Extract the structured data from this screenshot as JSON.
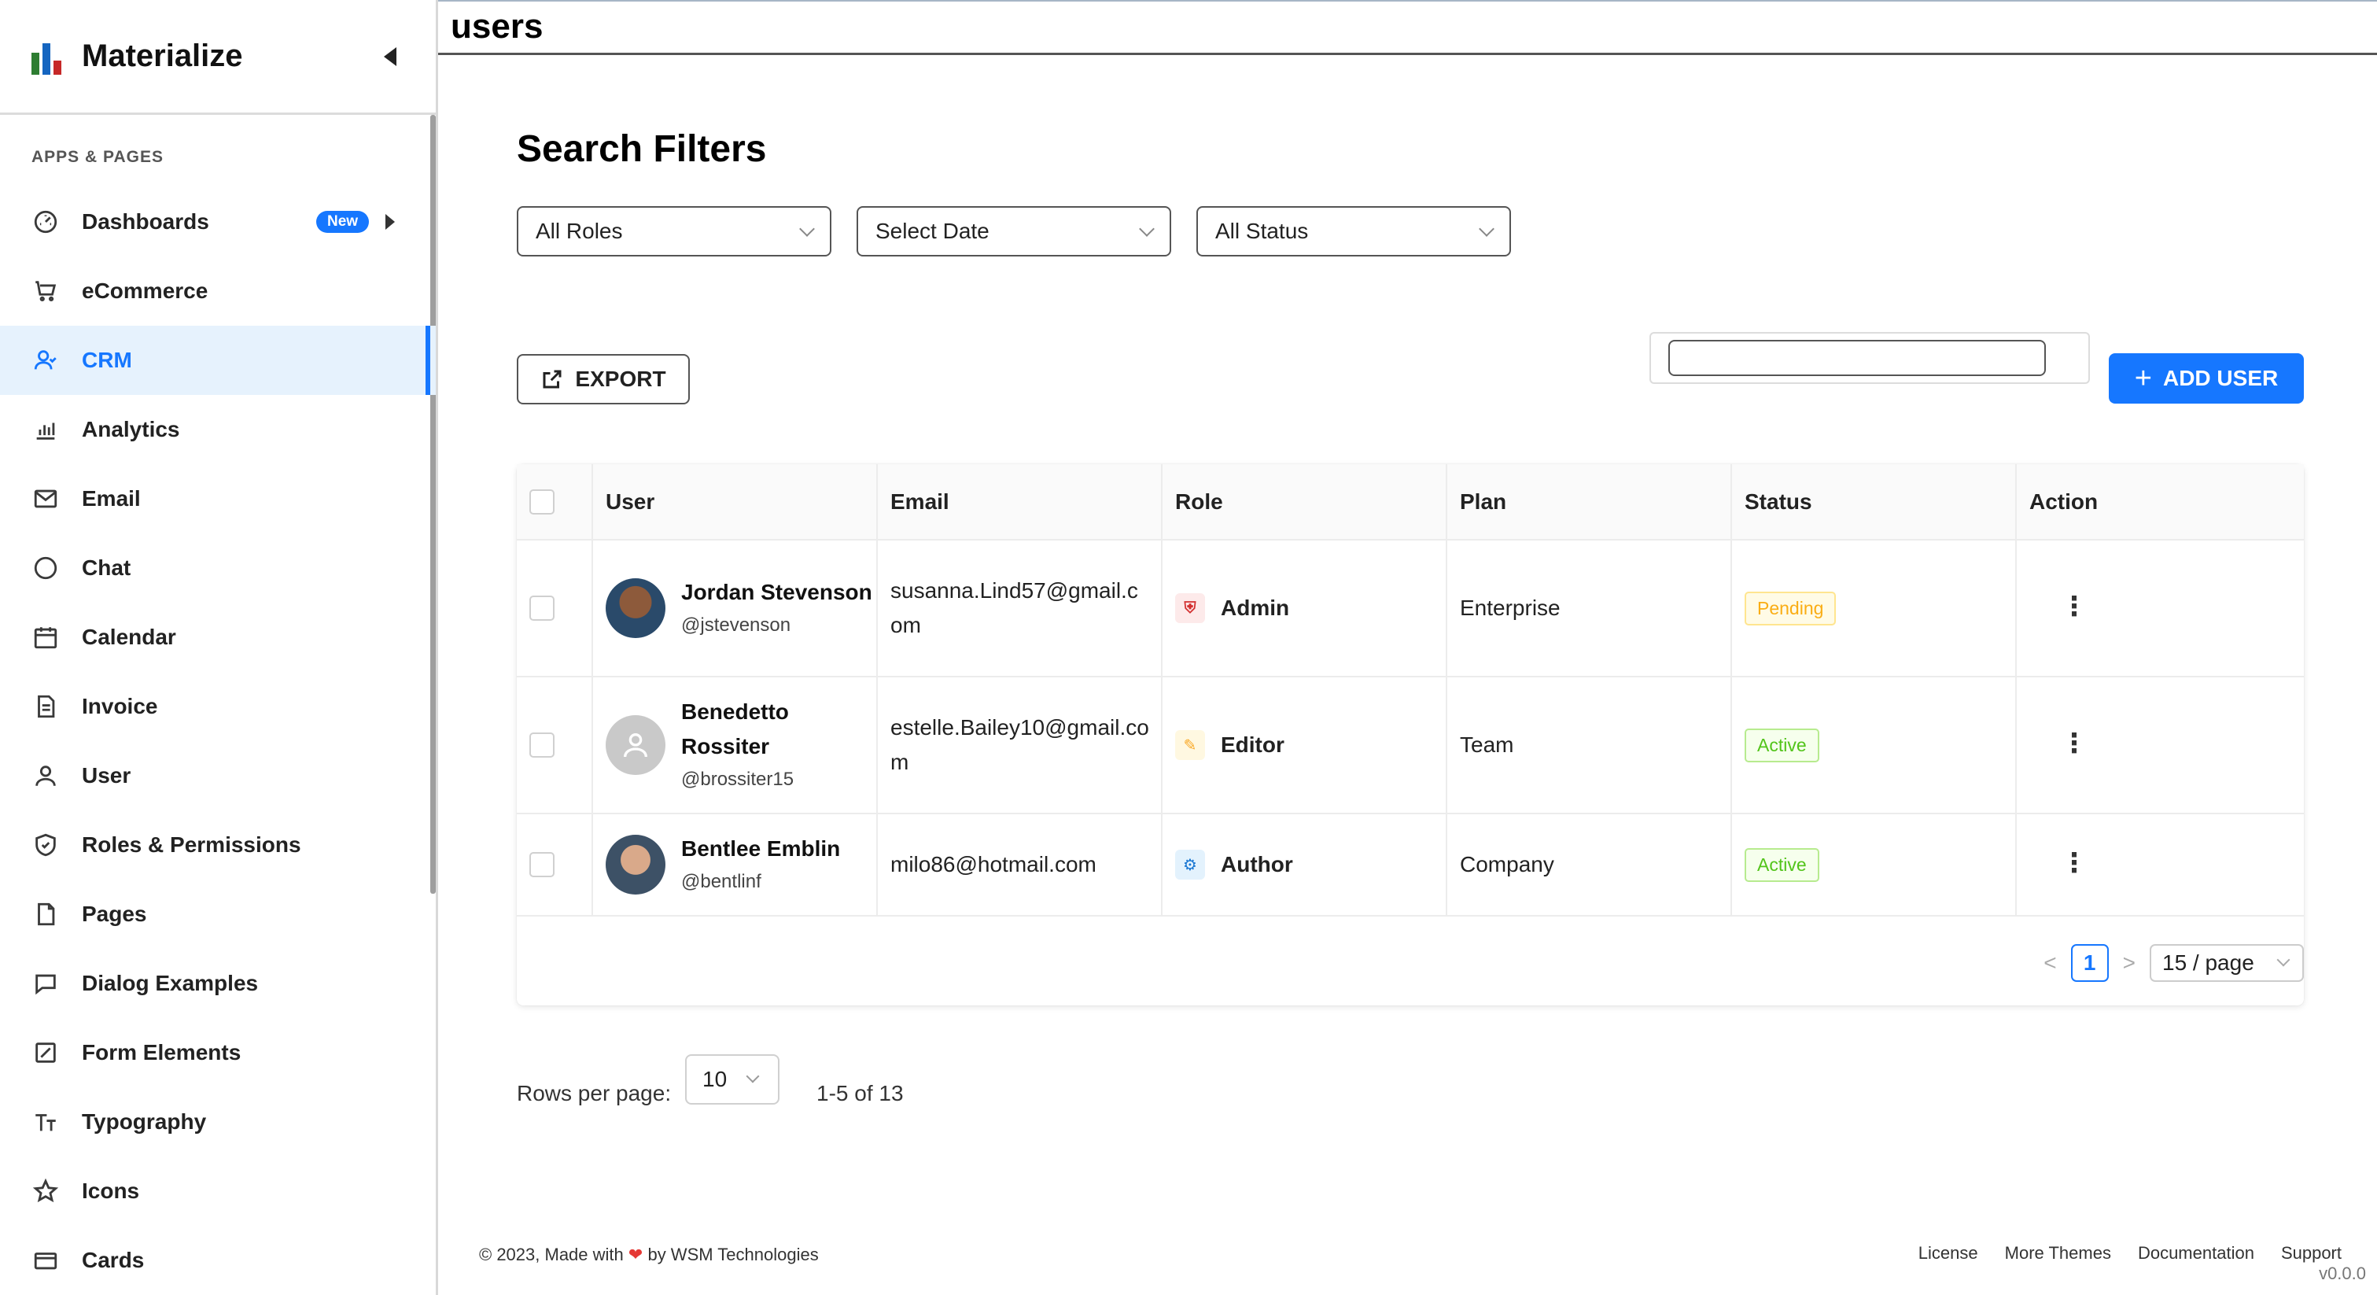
{
  "brand": {
    "name": "Materialize"
  },
  "sidebar": {
    "section_label": "APPS & PAGES",
    "items": [
      {
        "label": "Dashboards",
        "icon": "dashboard-icon",
        "badge": "New"
      },
      {
        "label": "eCommerce",
        "icon": "cart-icon"
      },
      {
        "label": "CRM",
        "icon": "crm-icon",
        "active": true
      },
      {
        "label": "Analytics",
        "icon": "analytics-icon"
      },
      {
        "label": "Email",
        "icon": "email-icon"
      },
      {
        "label": "Chat",
        "icon": "chat-icon"
      },
      {
        "label": "Calendar",
        "icon": "calendar-icon"
      },
      {
        "label": "Invoice",
        "icon": "invoice-icon"
      },
      {
        "label": "User",
        "icon": "user-icon"
      },
      {
        "label": "Roles & Permissions",
        "icon": "shield-icon"
      },
      {
        "label": "Pages",
        "icon": "page-icon"
      },
      {
        "label": "Dialog Examples",
        "icon": "dialog-icon"
      },
      {
        "label": "Form Elements",
        "icon": "form-icon"
      },
      {
        "label": "Typography",
        "icon": "typography-icon"
      },
      {
        "label": "Icons",
        "icon": "star-icon"
      },
      {
        "label": "Cards",
        "icon": "card-icon"
      }
    ]
  },
  "header": {
    "title": "users"
  },
  "filters": {
    "title": "Search Filters",
    "role": "All Roles",
    "date": "Select Date",
    "status": "All Status"
  },
  "toolbar": {
    "export_label": "EXPORT",
    "search_value": "",
    "add_label": "ADD USER"
  },
  "table": {
    "columns": [
      "User",
      "Email",
      "Role",
      "Plan",
      "Status",
      "Action"
    ],
    "rows": [
      {
        "name": "Jordan Stevenson",
        "handle": "@jstevenson",
        "email": "susanna.Lind57@gmail.com",
        "role": "Admin",
        "plan": "Enterprise",
        "status": "Pending"
      },
      {
        "name": "Benedetto Rossiter",
        "handle": "@brossiter15",
        "email": "estelle.Bailey10@gmail.com",
        "role": "Editor",
        "plan": "Team",
        "status": "Active"
      },
      {
        "name": "Bentlee Emblin",
        "handle": "@bentlinf",
        "email": "milo86@hotmail.com",
        "role": "Author",
        "plan": "Company",
        "status": "Active"
      }
    ]
  },
  "pagination": {
    "current_page": "1",
    "page_size": "15 / page",
    "prev": "<",
    "next": ">"
  },
  "rows_per_page": {
    "label": "Rows per page:",
    "value": "10",
    "range": "1-5 of 13"
  },
  "footer": {
    "copyright_prefix": "© 2023, Made with",
    "copyright_suffix": "by WSM Technologies",
    "links": [
      "License",
      "More Themes",
      "Documentation",
      "Support"
    ],
    "version": "v0.0.0"
  },
  "colors": {
    "primary": "#1677ff",
    "pending": "#faad14",
    "active": "#52c41a"
  }
}
